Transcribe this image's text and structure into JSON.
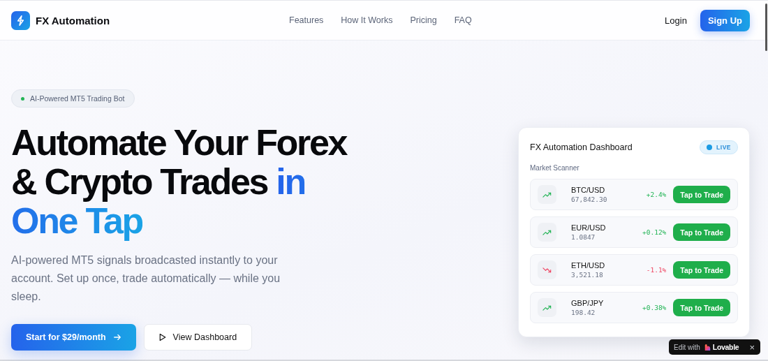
{
  "header": {
    "brand": "FX Automation",
    "nav": [
      "Features",
      "How It Works",
      "Pricing",
      "FAQ"
    ],
    "login": "Login",
    "signup": "Sign Up"
  },
  "hero": {
    "badge": "AI-Powered MT5 Trading Bot",
    "headline": "Automate Your Forex & Crypto Trades",
    "headline_highlight": "in One Tap",
    "description": "AI-powered MT5 signals broadcasted instantly to your account. Set up once, trade automatically — while you sleep.",
    "primary_button": "Start for $29/month",
    "secondary_button": "View Dashboard"
  },
  "dashboard": {
    "title": "FX Automation Dashboard",
    "status": "LIVE",
    "section": "Market Scanner",
    "pairs": [
      {
        "symbol": "BTC/USD",
        "price": "67,842.30",
        "change": "+2.4%",
        "kind": "up",
        "action": "Tap to Trade"
      },
      {
        "symbol": "EUR/USD",
        "price": "1.0847",
        "change": "+0.12%",
        "kind": "up",
        "action": "Tap to Trade"
      },
      {
        "symbol": "ETH/USD",
        "price": "3,521.18",
        "change": "-1.1%",
        "kind": "down",
        "action": "Tap to Trade"
      },
      {
        "symbol": "GBP/JPY",
        "price": "198.42",
        "change": "+0.38%",
        "kind": "up",
        "action": "Tap to Trade"
      }
    ]
  },
  "edit_badge": {
    "label": "Edit with",
    "brand": "Lovable",
    "close": "×"
  }
}
